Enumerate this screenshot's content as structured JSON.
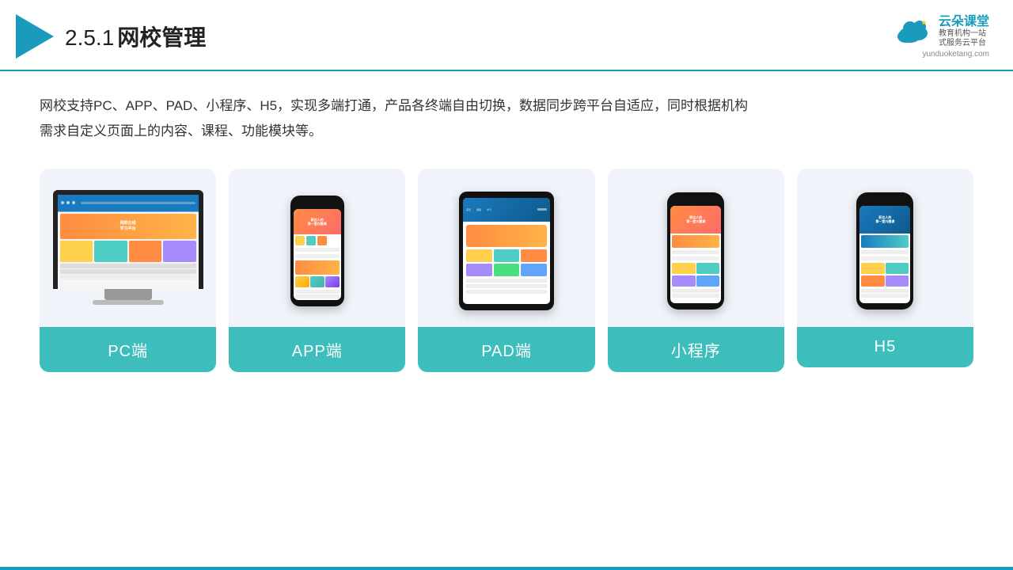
{
  "header": {
    "section": "2.5.1",
    "title": "网校管理",
    "brand": {
      "name": "云朵课堂",
      "slogan": "教育机构一站\n式服务云平台",
      "url": "yunduoketang.com"
    }
  },
  "description": "网校支持PC、APP、PAD、小程序、H5，实现多端打通，产品各终端自由切换，数据同步跨平台自适应，同时根据机构\n需求自定义页面上的内容、课程、功能模块等。",
  "devices": [
    {
      "id": "pc",
      "label": "PC端"
    },
    {
      "id": "app",
      "label": "APP端"
    },
    {
      "id": "pad",
      "label": "PAD端"
    },
    {
      "id": "miniapp",
      "label": "小程序"
    },
    {
      "id": "h5",
      "label": "H5"
    }
  ],
  "colors": {
    "accent": "#1a9bbd",
    "card_bg": "#f0f4fa",
    "label_bg": "#3dbdbb",
    "label_text": "#ffffff"
  }
}
